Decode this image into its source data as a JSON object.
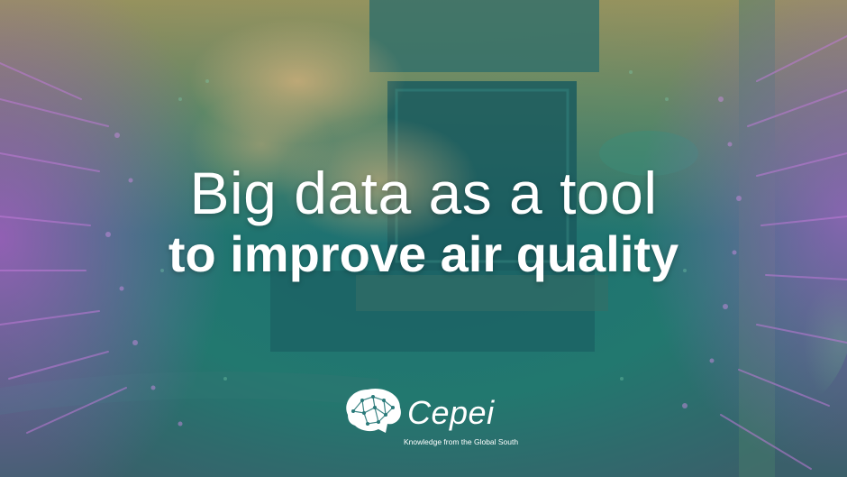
{
  "banner": {
    "title_line1": "Big data as a tool",
    "title_line2": "to improve air quality"
  },
  "logo": {
    "name": "Cepei",
    "tagline": "Knowledge from the Global South",
    "icon": "brain-network-icon"
  },
  "colors": {
    "overlay_teal": "#1f7a7a",
    "overlay_purple": "#8a5fb5",
    "overlay_gold": "#b59a5a",
    "text": "#ffffff"
  }
}
